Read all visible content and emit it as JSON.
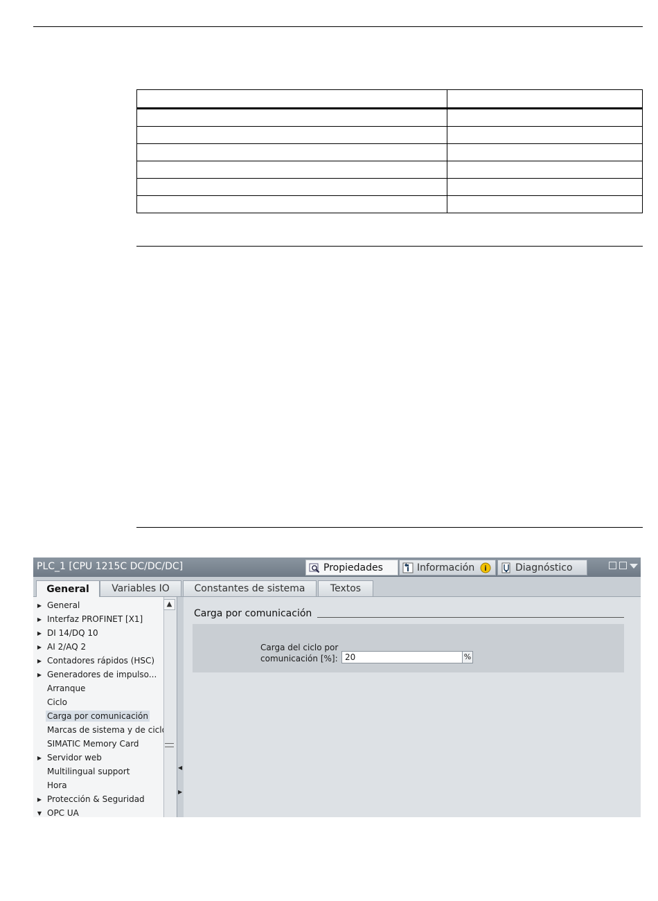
{
  "window": {
    "title": "PLC_1 [CPU 1215C DC/DC/DC]",
    "tabs": [
      {
        "label": "Propiedades",
        "icon": "properties-icon",
        "active": true
      },
      {
        "label": "Información",
        "icon": "info-icon",
        "active": false
      },
      {
        "label": "Diagnóstico",
        "icon": "diagnostics-icon",
        "active": false
      }
    ]
  },
  "subtabs": [
    {
      "label": "General",
      "active": true
    },
    {
      "label": "Variables IO",
      "active": false
    },
    {
      "label": "Constantes de sistema",
      "active": false
    },
    {
      "label": "Textos",
      "active": false
    }
  ],
  "nav": [
    {
      "label": "General",
      "expander": "collapsed"
    },
    {
      "label": "Interfaz PROFINET [X1]",
      "expander": "collapsed"
    },
    {
      "label": "DI 14/DQ 10",
      "expander": "collapsed"
    },
    {
      "label": "AI 2/AQ 2",
      "expander": "collapsed"
    },
    {
      "label": "Contadores rápidos (HSC)",
      "expander": "collapsed"
    },
    {
      "label": "Generadores de impulso...",
      "expander": "collapsed"
    },
    {
      "label": "Arranque",
      "expander": "none"
    },
    {
      "label": "Ciclo",
      "expander": "none"
    },
    {
      "label": "Carga por comunicación",
      "expander": "none",
      "selected": true
    },
    {
      "label": "Marcas de sistema y de ciclo",
      "expander": "none"
    },
    {
      "label": "SIMATIC Memory Card",
      "expander": "none"
    },
    {
      "label": "Servidor web",
      "expander": "collapsed"
    },
    {
      "label": "Multilingual support",
      "expander": "none"
    },
    {
      "label": "Hora",
      "expander": "none"
    },
    {
      "label": "Protección & Seguridad",
      "expander": "collapsed"
    },
    {
      "label": "OPC UA",
      "expander": "expanded"
    }
  ],
  "section": {
    "title": "Carga por comunicación",
    "field_label_line1": "Carga del ciclo por",
    "field_label_line2": "comunicación [%]:",
    "field_value": "20",
    "unit": "%"
  },
  "colors": {
    "titlebar": "#7b8692",
    "panel_bg": "#dde1e5",
    "group_bg": "#c9ced3",
    "selection": "#d7dee6"
  }
}
